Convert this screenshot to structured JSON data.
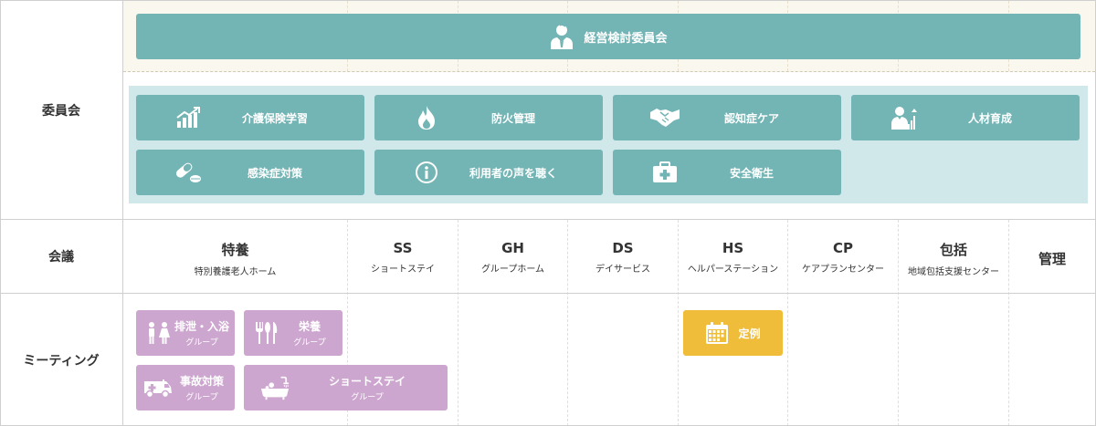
{
  "rows": {
    "committee": "委員会",
    "meeting": "会議",
    "mtg": "ミーティング"
  },
  "main_committee": {
    "label": "経営検討委員会",
    "icon": "person-icon"
  },
  "committees": [
    {
      "label": "介護保険学習",
      "icon": "chart-icon"
    },
    {
      "label": "防火管理",
      "icon": "fire-icon"
    },
    {
      "label": "認知症ケア",
      "icon": "handshake-icon"
    },
    {
      "label": "人材育成",
      "icon": "growth-icon"
    },
    {
      "label": "感染症対策",
      "icon": "pill-icon"
    },
    {
      "label": "利用者の声を聴く",
      "icon": "info-icon"
    },
    {
      "label": "安全衛生",
      "icon": "first-aid-icon"
    }
  ],
  "meetings": [
    {
      "abbr": "特養",
      "full": "特別養護老人ホーム"
    },
    {
      "abbr": "SS",
      "full": "ショートステイ"
    },
    {
      "abbr": "GH",
      "full": "グループホーム"
    },
    {
      "abbr": "DS",
      "full": "デイサービス"
    },
    {
      "abbr": "HS",
      "full": "ヘルパーステーション"
    },
    {
      "abbr": "CP",
      "full": "ケアプランセンター"
    },
    {
      "abbr": "包括",
      "full": "地域包括支援センター"
    },
    {
      "abbr": "管理",
      "full": ""
    }
  ],
  "groups": [
    {
      "label": "排泄・入浴",
      "sub": "グループ",
      "icon": "toilet-icon"
    },
    {
      "label": "栄養",
      "sub": "グループ",
      "icon": "cutlery-icon"
    },
    {
      "label": "事故対策",
      "sub": "グループ",
      "icon": "ambulance-icon"
    },
    {
      "label": "ショートステイ",
      "sub": "グループ",
      "icon": "bath-icon"
    }
  ],
  "regular": {
    "label": "定例",
    "icon": "calendar-icon"
  },
  "colors": {
    "teal": "#73b4b5",
    "light_teal": "#d1e8eb",
    "purple": "#cda6cf",
    "yellow": "#f0bd3a",
    "cream": "#faf7ee"
  }
}
